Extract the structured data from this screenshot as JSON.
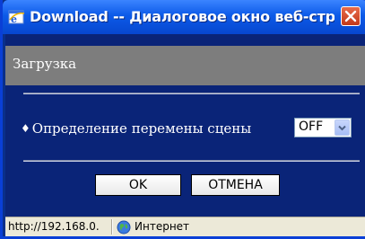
{
  "window": {
    "title": "Download -- Диалоговое окно веб-стр...",
    "icon": "ie-icon",
    "close_icon": "close-icon"
  },
  "dialog": {
    "header": "Загрузка",
    "option": {
      "bullet": "♦",
      "label": "Определение перемены сцены",
      "select_value": "OFF"
    },
    "buttons": {
      "ok": "OK",
      "cancel": "ОТМЕНА"
    }
  },
  "statusbar": {
    "url": "http://192.168.0.",
    "zone_icon": "globe-icon",
    "zone": "Интернет"
  },
  "colors": {
    "titlebar": "#0c5ae8",
    "content_bg": "#0a2478",
    "header_bar": "#7d7d7d",
    "close_button": "#c2391a"
  }
}
